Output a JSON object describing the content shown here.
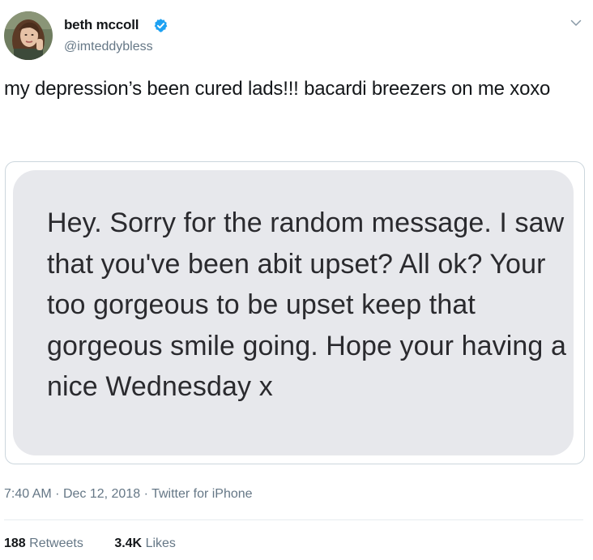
{
  "tweet": {
    "author": {
      "name": "beth mccoll",
      "handle": "@imteddybless",
      "verified": true
    },
    "text": "my depression’s been cured lads!!! bacardi breezers on me xoxo",
    "media": {
      "message_text": "Hey. Sorry for the random message. I saw that you've been abit upset? All ok? Your too gorgeous to be upset keep that gorgeous smile going. Hope your having a nice Wednesday x"
    },
    "meta": {
      "time": "7:40 AM",
      "date": "Dec 12, 2018",
      "source": "Twitter for iPhone",
      "separator": "·"
    },
    "stats": {
      "retweets_count": "188",
      "retweets_label": "Retweets",
      "likes_count": "3.4K",
      "likes_label": "Likes"
    }
  },
  "icons": {
    "verified": "verified-badge-icon",
    "more": "chevron-down-icon"
  },
  "colors": {
    "text_primary": "#14171a",
    "text_secondary": "#657786",
    "verified_blue": "#1da1f2",
    "bubble_gray": "#e7e8ec",
    "border": "#ccd6dd"
  }
}
